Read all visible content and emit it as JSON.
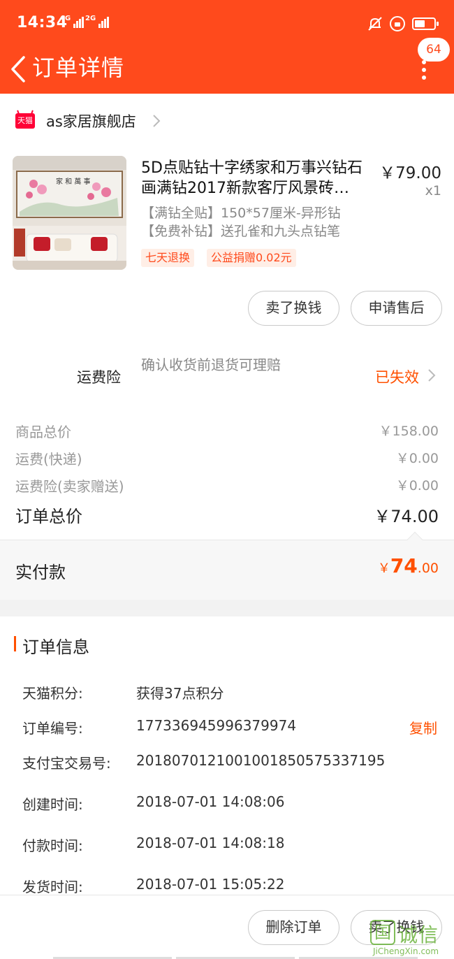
{
  "status_bar": {
    "time": "14:34",
    "net1": "4G",
    "net2": "2G"
  },
  "nav": {
    "title": "订单详情",
    "badge_count": "64"
  },
  "shop": {
    "badge": "天猫",
    "name": "as家居旗舰店"
  },
  "product": {
    "title": "5D点贴钻十字绣家和万事兴钻石画满钻2017新款客厅风景砖…",
    "price": "￥79.00",
    "qty": "x1",
    "sku_line1": "【满钻全贴】150*57厘米-异形钻",
    "sku_line2": "【免费补钻】送孔雀和九头点钻笔",
    "tags": [
      "七天退换",
      "公益捐赠0.02元"
    ]
  },
  "actions": {
    "sell_label": "卖了换钱",
    "after_sale_label": "申请售后"
  },
  "insurance": {
    "label": "运费险",
    "desc": "确认收货前退货可理赔",
    "status": "已失效"
  },
  "prices": [
    {
      "label": "商品总价",
      "value": "￥158.00"
    },
    {
      "label": "运费(快递)",
      "value": "￥0.00"
    },
    {
      "label": "运费险(卖家赠送)",
      "value": "￥0.00"
    }
  ],
  "total": {
    "label": "订单总价",
    "value": "￥74.00"
  },
  "paid": {
    "label": "实付款",
    "currency": "￥",
    "integer": "74",
    "decimal": ".00"
  },
  "order_info": {
    "title": "订单信息",
    "rows": [
      {
        "key": "天猫积分:",
        "value": "获得37点积分"
      },
      {
        "key": "订单编号:",
        "value": "1773369459963799 74",
        "action": "复制"
      },
      {
        "key": "支付宝交易号:",
        "value": "2018070121001001850575337195"
      },
      {
        "key": "创建时间:",
        "value": "2018-07-01 14:08:06"
      },
      {
        "key": "付款时间:",
        "value": "2018-07-01 14:08:18"
      },
      {
        "key": "发货时间:",
        "value": "2018-07-01 15:05:22"
      }
    ]
  },
  "bottom": {
    "delete_label": "删除订单",
    "sell_label": "卖了换钱"
  },
  "watermark": {
    "logo": "国",
    "text": "诚信",
    "sub": "JiChengXin.com"
  }
}
